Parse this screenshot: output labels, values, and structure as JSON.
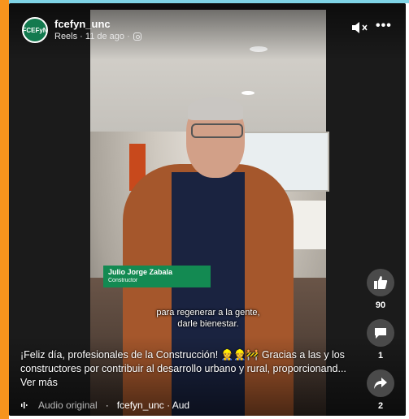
{
  "post": {
    "avatar_text": "FCEFyN",
    "username": "fcefyn_unc",
    "meta": "Reels · 11 de ago ·"
  },
  "video": {
    "lower_third_name": "Julio Jorge Zabala",
    "lower_third_role": "Constructor",
    "subtitle_line1": "para regenerar a la gente,",
    "subtitle_line2": "darle bienestar."
  },
  "actions": {
    "likes": "90",
    "comments": "1",
    "shares": "2"
  },
  "caption": {
    "text": "¡Feliz día, profesionales de la Construcción! 👷👷🚧 Gracias a las y los constructores por contribuir al desarrollo urbano y rural, proporcionand...",
    "see_more": "Ver más"
  },
  "audio": {
    "label": "Audio original",
    "separator": "·",
    "source": "fcefyn_unc · Aud"
  },
  "colors": {
    "accent_left": "#f7941d",
    "accent_top": "#7fd4e6",
    "brand_green": "#138a52"
  },
  "icons": [
    "mute-icon",
    "more-icon",
    "instagram-icon",
    "like-icon",
    "comment-icon",
    "share-icon",
    "audio-wave-icon"
  ]
}
